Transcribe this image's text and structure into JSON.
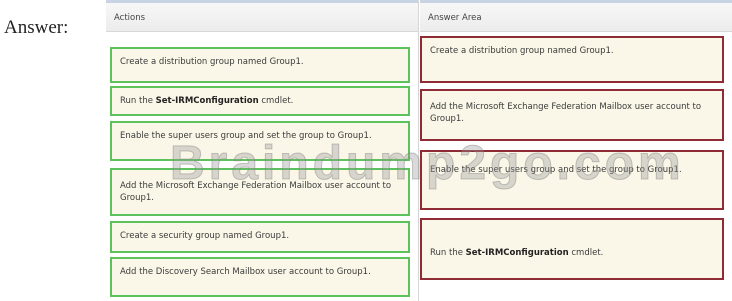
{
  "label": "Answer:",
  "actions": {
    "header": "Actions",
    "items": [
      {
        "pre": "Create a distribution group named Group1.",
        "bold": "",
        "post": ""
      },
      {
        "pre": "Run the ",
        "bold": "Set-IRMConfiguration",
        "post": " cmdlet."
      },
      {
        "pre": "Enable the super users group and set the group to Group1.",
        "bold": "",
        "post": ""
      },
      {
        "pre": "Add the Microsoft Exchange Federation Mailbox user account to Group1.",
        "bold": "",
        "post": ""
      },
      {
        "pre": "Create a security group named Group1.",
        "bold": "",
        "post": ""
      },
      {
        "pre": "Add the Discovery Search Mailbox user account to Group1.",
        "bold": "",
        "post": ""
      }
    ]
  },
  "answer": {
    "header": "Answer Area",
    "items": [
      {
        "pre": "Create a distribution group named Group1.",
        "bold": "",
        "post": ""
      },
      {
        "pre": "Add the Microsoft Exchange Federation Mailbox user account to Group1.",
        "bold": "",
        "post": ""
      },
      {
        "pre": "Enable the super users group and set the group to Group1.",
        "bold": "",
        "post": ""
      },
      {
        "pre": "Run the ",
        "bold": "Set-IRMConfiguration",
        "post": " cmdlet."
      }
    ]
  },
  "watermark": "Braindump2go.com"
}
